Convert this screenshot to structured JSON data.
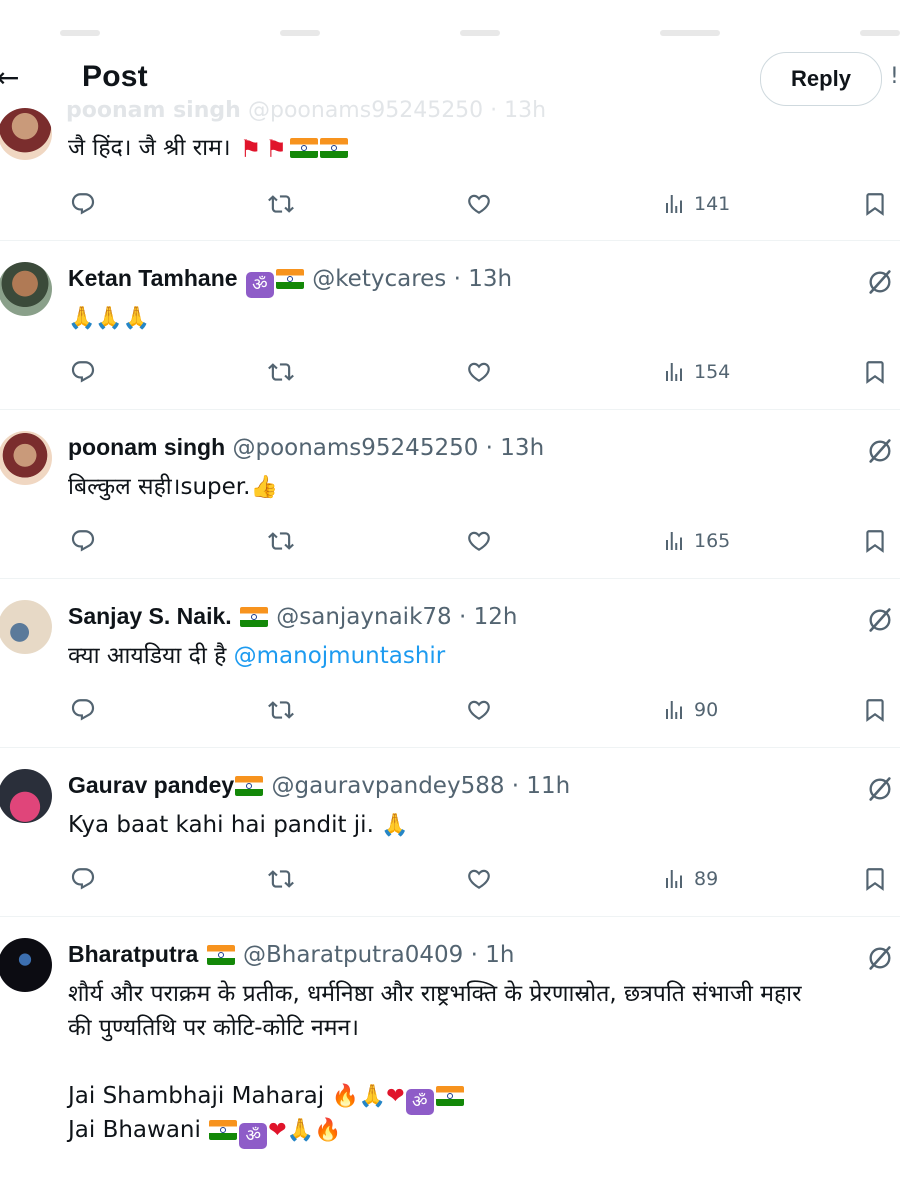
{
  "header": {
    "title": "Post",
    "reply_label": "Reply",
    "ghost_name": "poonam singh",
    "ghost_handle": "@poonams95245250 · 13h"
  },
  "tweets": [
    {
      "text": "जै हिंद। जै श्री राम।",
      "views": "141"
    },
    {
      "name": "Ketan Tamhane",
      "handle": "@ketycares",
      "time": "13h",
      "views": "154"
    },
    {
      "name": "poonam singh",
      "handle": "@poonams95245250",
      "time": "13h",
      "text": "बिल्कुल सही।super.",
      "views": "165"
    },
    {
      "name": "Sanjay S. Naik.",
      "handle": "@sanjaynaik78",
      "time": "12h",
      "text": "क्या आयडिया दी है",
      "mention": "@manojmuntashir",
      "views": "90"
    },
    {
      "name": "Gaurav pandey",
      "handle": "@gauravpandey588",
      "time": "11h",
      "text": "Kya baat kahi hai pandit ji.",
      "views": "89"
    },
    {
      "name": "Bharatputra",
      "handle": "@Bharatputra0409",
      "time": "1h",
      "line1": "शौर्य और पराक्रम के प्रतीक, धर्मनिष्ठा और राष्ट्रभक्ति के प्रेरणास्रोत, छत्रपति संभाजी महार",
      "line2": "की पुण्यतिथि पर कोटि-कोटि नमन।",
      "line3": "Jai Shambhaji Maharaj",
      "line4": "Jai Bhawani"
    }
  ],
  "separator": "·",
  "icons": {
    "reply": "reply-icon",
    "retweet": "retweet-icon",
    "like": "heart-icon",
    "views": "views-icon",
    "bookmark": "bookmark-icon",
    "grok": "grok-icon"
  },
  "colors": {
    "text": "#0f1419",
    "muted": "#536471",
    "link": "#1d9bf0",
    "divider": "#eff3f4"
  }
}
